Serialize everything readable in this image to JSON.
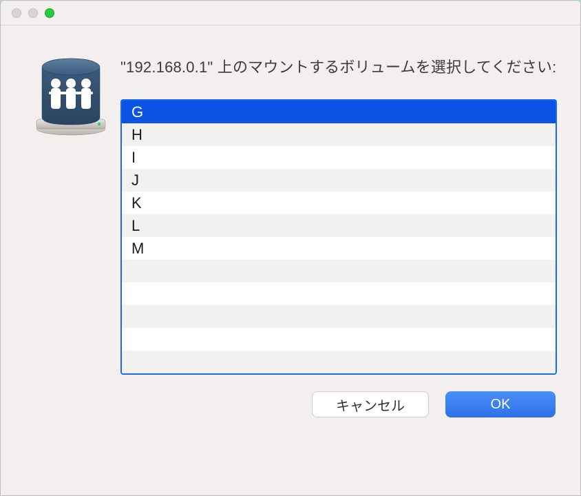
{
  "prompt": "\"192.168.0.1\" 上のマウントするボリュームを選択してください:",
  "volumes": [
    "G",
    "H",
    "I",
    "J",
    "K",
    "L",
    "M"
  ],
  "selected_index": 0,
  "buttons": {
    "cancel": "キャンセル",
    "ok": "OK"
  },
  "blank_rows": 5
}
